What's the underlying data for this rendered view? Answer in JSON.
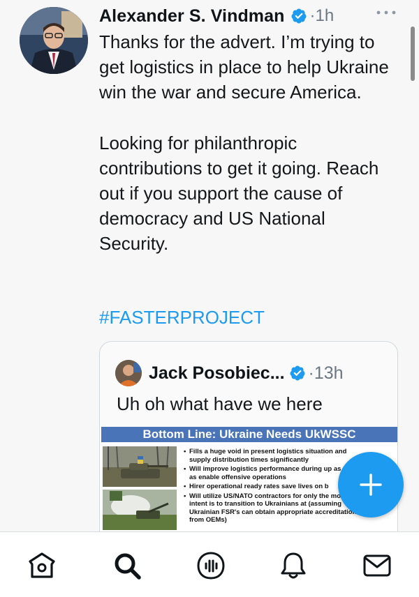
{
  "tweet": {
    "author_name": "Alexander S. Vindman",
    "separator": "·",
    "time": "1h",
    "paragraph1": "Thanks for the advert. I’m trying to get logistics in place to help Ukraine win the war and secure America.",
    "paragraph2": "Looking for philanthropic contributions to get it going. Reach out if you support the cause of democracy and US National Security.",
    "hashtag": "#FASTERPROJECT"
  },
  "quote": {
    "author_name": "Jack Posobiec...",
    "separator": "·",
    "time": "13h",
    "text": "Uh oh what have we here",
    "slide_title": "Bottom Line: Ukraine Needs UkWSSC",
    "bullets": [
      "Fills a huge void in present logistics situation and supply distribution times significantly",
      "Will improve logistics performance during up as well as enable offensive operations",
      "Hirer operational ready rates save lives on b",
      "Will utilize US/NATO contractors for only the months; intent is to transition to Ukrainians at (assuming Ukrainian FSR's can obtain appropriate accreditation from OEMs)"
    ]
  },
  "icons": {
    "verified": "verified-badge-icon",
    "more": "more-options-icon",
    "compose": "compose-plus-icon",
    "home": "home-icon",
    "search": "search-icon",
    "spaces": "spaces-icon",
    "notifications": "notifications-bell-icon",
    "messages": "messages-envelope-icon"
  },
  "colors": {
    "accent": "#1d9bf0",
    "slide_banner": "#4a74b8",
    "secondary_text": "#6b7783"
  }
}
